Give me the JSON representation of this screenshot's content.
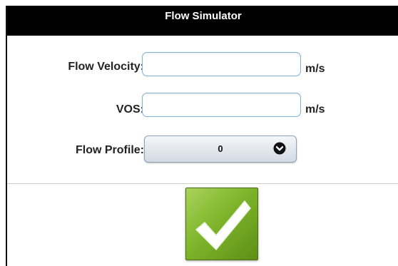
{
  "window": {
    "title": "Flow Simulator"
  },
  "form": {
    "flow_velocity": {
      "label": "Flow Velocity:",
      "value": "",
      "unit": "m/s"
    },
    "vos": {
      "label": "VOS:",
      "value": "",
      "unit": "m/s"
    },
    "flow_profile": {
      "label": "Flow Profile:",
      "selected": "0",
      "icon": "chevron-down-circle-icon"
    }
  },
  "submit": {
    "icon": "checkmark-icon",
    "color": "#7fb52b"
  },
  "colors": {
    "title_bar": "#000000",
    "input_border": "#7fb3d9"
  }
}
